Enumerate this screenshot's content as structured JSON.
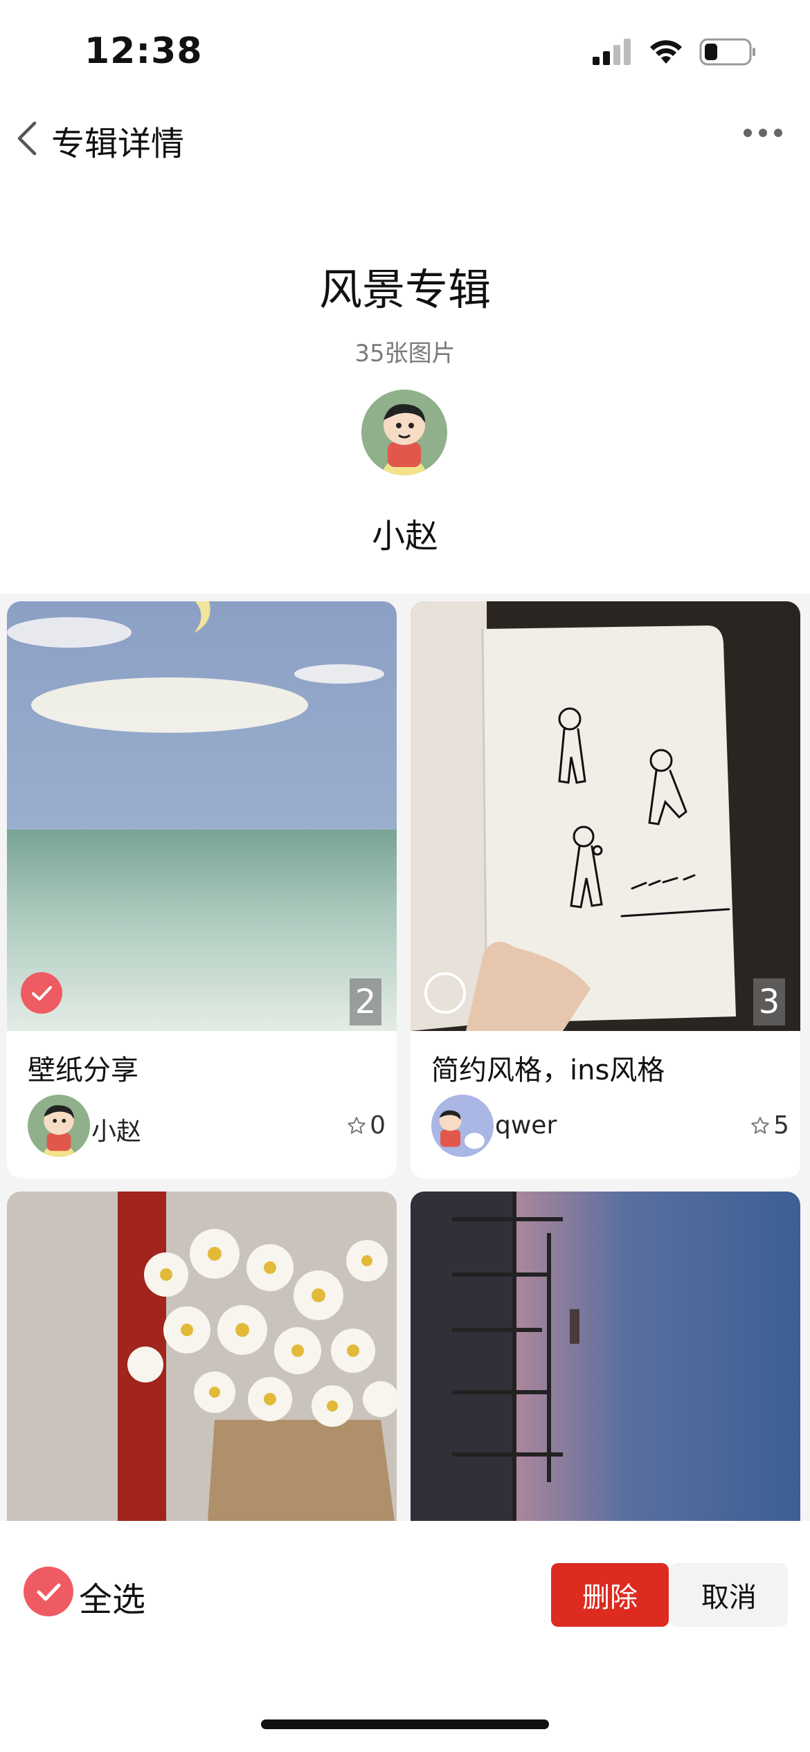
{
  "status_bar": {
    "time": "12:38"
  },
  "nav": {
    "title": "专辑详情"
  },
  "album": {
    "title": "风景专辑",
    "count_label": "35张图片",
    "owner_name": "小赵"
  },
  "cards": [
    {
      "title": "壁纸分享",
      "author": "小赵",
      "likes": "0",
      "index": "2",
      "selected": true
    },
    {
      "title": "简约风格，ins风格",
      "author": "qwer",
      "likes": "5",
      "index": "3",
      "selected": false
    },
    {
      "title": "",
      "author": "",
      "likes": "",
      "index": "",
      "selected": false
    },
    {
      "title": "",
      "author": "",
      "likes": "",
      "index": "",
      "selected": false
    }
  ],
  "bottom_bar": {
    "select_all_label": "全选",
    "delete_label": "删除",
    "cancel_label": "取消"
  },
  "colors": {
    "accent_red": "#dd2b20",
    "check_red": "#ef5b62"
  }
}
